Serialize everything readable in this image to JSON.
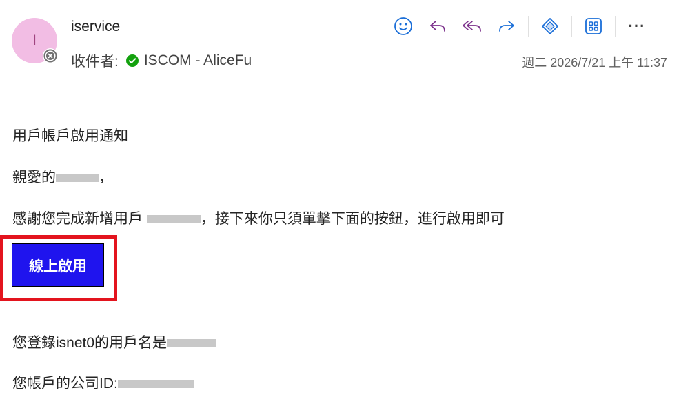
{
  "header": {
    "avatar_initial": "I",
    "sender_name": "iservice",
    "recipient_prefix": "收件者:",
    "recipient_name": "ISCOM - AliceFu",
    "date": "週二 2026/7/21 上午 11:37"
  },
  "toolbar": {
    "icons": [
      "emoji-icon",
      "reply-icon",
      "reply-all-icon",
      "forward-icon",
      "viva-insights-icon",
      "apps-icon",
      "more-icon"
    ],
    "more_label": "···"
  },
  "body": {
    "title": "用戶帳戶啟用通知",
    "greeting_prefix": "親愛的",
    "greeting_suffix": "，",
    "line1_prefix": "感謝您完成新增用戶 ",
    "line1_suffix": "，接下來你只須單擊下面的按鈕，進行啟用即可",
    "button_label": "線上啟用",
    "line2_prefix": "您登錄isnet0的用戶名是",
    "line3_prefix": "您帳戶的公司ID:"
  },
  "colors": {
    "accent": "#1f14ee",
    "highlight_border": "#e3141e",
    "avatar_bg": "#f2bde4",
    "icon_blue": "#1a6ed8",
    "icon_purple": "#7a2f8a",
    "verified_green": "#13a10e"
  }
}
